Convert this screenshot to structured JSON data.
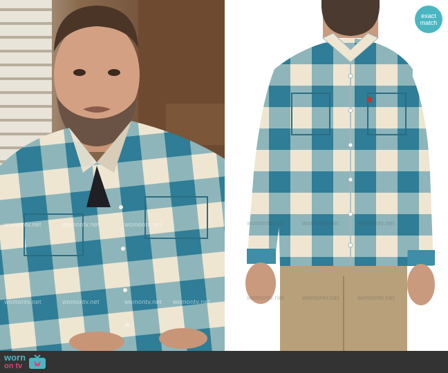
{
  "watermark": {
    "text": "womontv.net"
  },
  "badge": {
    "line1": "exact",
    "line2": "match"
  },
  "footer": {
    "logo_top": "worn",
    "logo_bottom": "on tv"
  },
  "colors": {
    "accent": "#4bb6c2",
    "logo_pink": "#e0407a",
    "plaid_blue": "#3d8ea6",
    "plaid_cream": "#efe6d2",
    "footer_bg": "#333333"
  }
}
